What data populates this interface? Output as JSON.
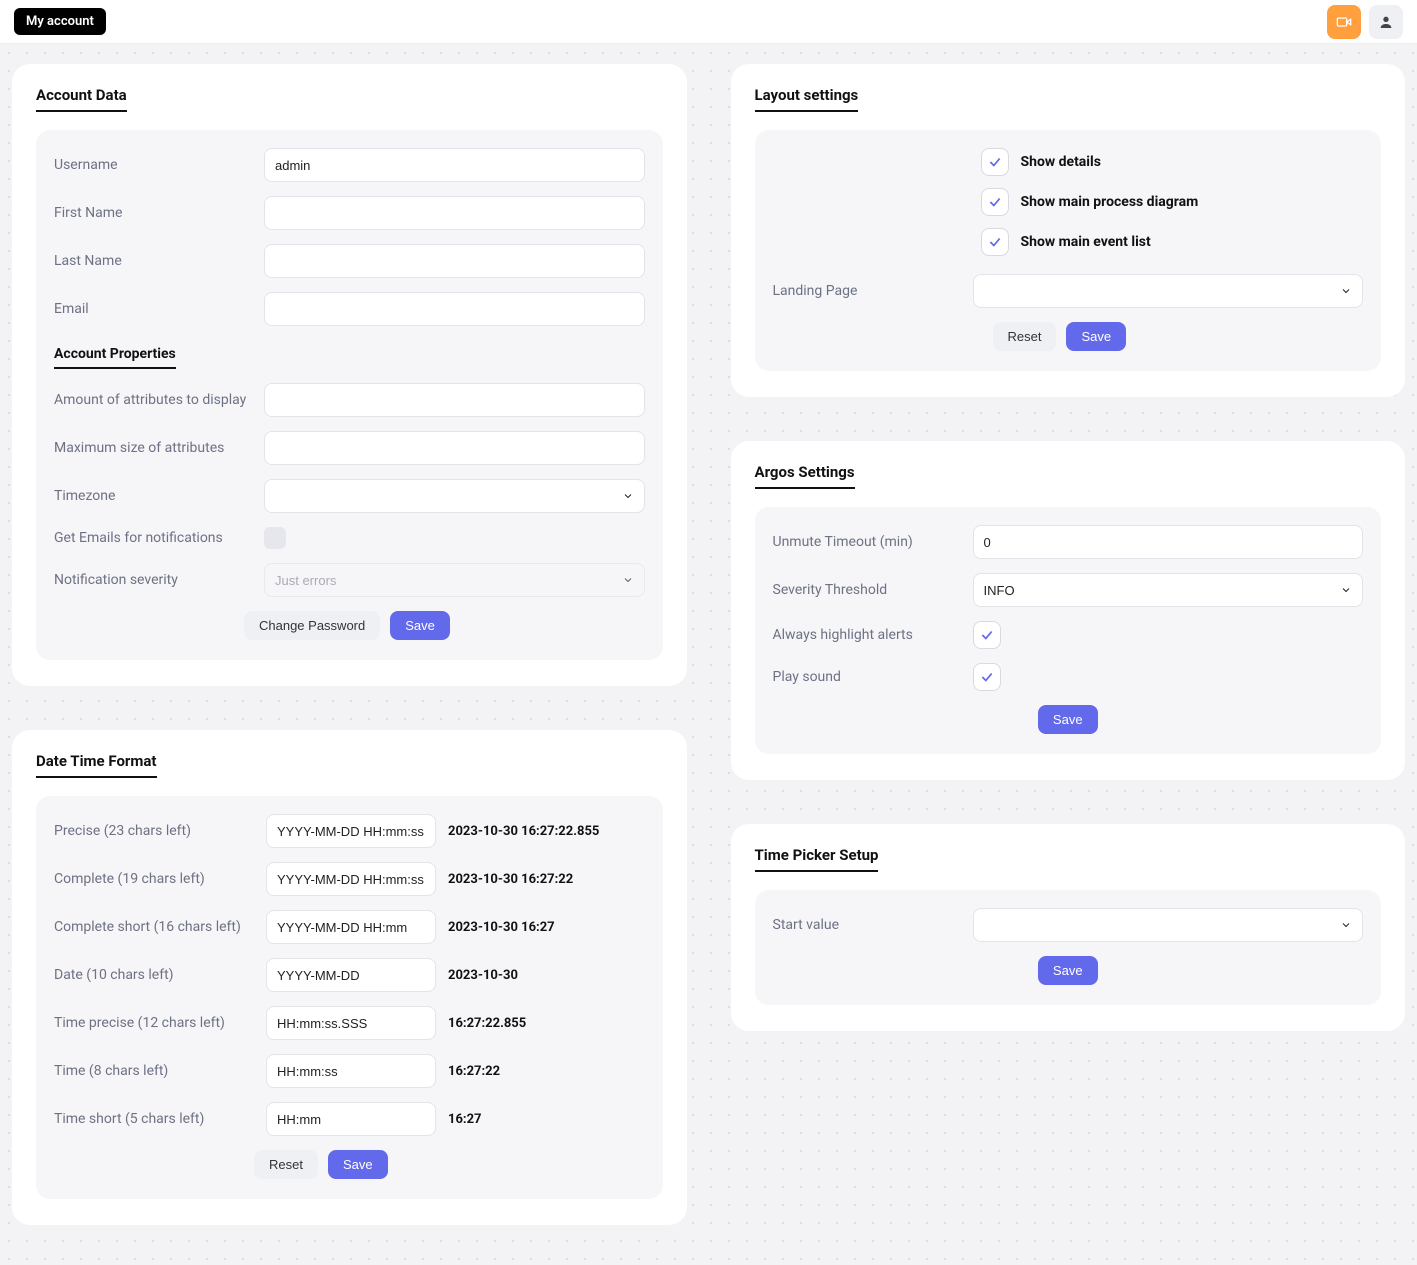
{
  "topbar": {
    "title": "My account"
  },
  "accountData": {
    "title": "Account Data",
    "usernameLabel": "Username",
    "username": "admin",
    "firstNameLabel": "First Name",
    "firstName": "",
    "lastNameLabel": "Last Name",
    "lastName": "",
    "emailLabel": "Email",
    "email": "",
    "propsTitle": "Account Properties",
    "attrDisplayLabel": "Amount of attributes to display",
    "attrDisplay": "",
    "maxSizeLabel": "Maximum size of attributes",
    "maxSize": "",
    "timezoneLabel": "Timezone",
    "timezone": "",
    "getEmailsLabel": "Get Emails for notifications",
    "notifSevLabel": "Notification severity",
    "notifSev": "Just errors",
    "changePassword": "Change Password",
    "save": "Save"
  },
  "dateTime": {
    "title": "Date Time Format",
    "rows": [
      {
        "label": "Precise (23 chars left)",
        "value": "YYYY-MM-DD HH:mm:ss.SSS",
        "example": "2023-10-30 16:27:22.855"
      },
      {
        "label": "Complete (19 chars left)",
        "value": "YYYY-MM-DD HH:mm:ss",
        "example": "2023-10-30 16:27:22"
      },
      {
        "label": "Complete short (16 chars left)",
        "value": "YYYY-MM-DD HH:mm",
        "example": "2023-10-30 16:27"
      },
      {
        "label": "Date (10 chars left)",
        "value": "YYYY-MM-DD",
        "example": "2023-10-30"
      },
      {
        "label": "Time precise (12 chars left)",
        "value": "HH:mm:ss.SSS",
        "example": "16:27:22.855"
      },
      {
        "label": "Time (8 chars left)",
        "value": "HH:mm:ss",
        "example": "16:27:22"
      },
      {
        "label": "Time short (5 chars left)",
        "value": "HH:mm",
        "example": "16:27"
      }
    ],
    "reset": "Reset",
    "save": "Save"
  },
  "layout": {
    "title": "Layout settings",
    "showDetails": "Show details",
    "showDiagram": "Show main process diagram",
    "showEventList": "Show main event list",
    "landingLabel": "Landing Page",
    "landing": "",
    "reset": "Reset",
    "save": "Save"
  },
  "argos": {
    "title": "Argos Settings",
    "unmuteLabel": "Unmute Timeout (min)",
    "unmute": "0",
    "sevLabel": "Severity Threshold",
    "sev": "INFO",
    "highlightLabel": "Always highlight alerts",
    "playSoundLabel": "Play sound",
    "save": "Save"
  },
  "timePicker": {
    "title": "Time Picker Setup",
    "startLabel": "Start value",
    "start": "",
    "save": "Save"
  }
}
